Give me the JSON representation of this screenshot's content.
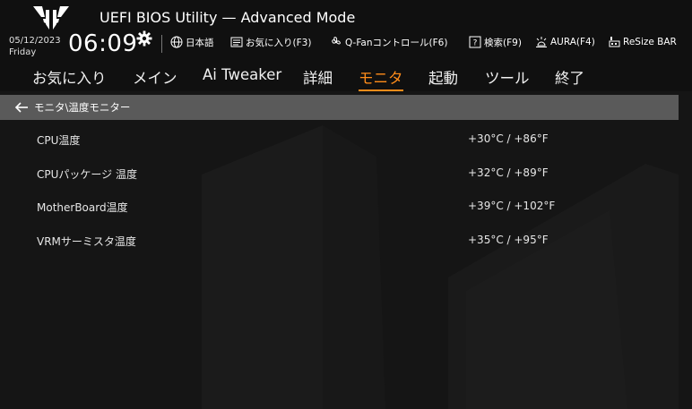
{
  "header": {
    "title": "UEFI BIOS Utility — Advanced Mode",
    "date": "05/12/2023",
    "day": "Friday",
    "time": "06:09"
  },
  "toolbar": {
    "language": "日本語",
    "favorites": "お気に入り(F3)",
    "qfan": "Q-Fanコントロール(F6)",
    "search": "検索(F9)",
    "aura": "AURA(F4)",
    "resize_bar": "ReSize BAR"
  },
  "nav": {
    "tabs": [
      {
        "label": "お気に入り"
      },
      {
        "label": "メイン"
      },
      {
        "label": "Ai Tweaker"
      },
      {
        "label": "詳細"
      },
      {
        "label": "モニタ"
      },
      {
        "label": "起動"
      },
      {
        "label": "ツール"
      },
      {
        "label": "終了"
      }
    ],
    "active": "モニタ"
  },
  "breadcrumb": {
    "text": "モニタ\\温度モニター"
  },
  "rows": [
    {
      "label": "CPU温度",
      "value": "+30°C / +86°F"
    },
    {
      "label": "CPUパッケージ 温度",
      "value": "+32°C / +89°F"
    },
    {
      "label": "MotherBoard温度",
      "value": "+39°C / +102°F"
    },
    {
      "label": "VRMサーミスタ温度",
      "value": "+35°C / +95°F"
    }
  ],
  "colors": {
    "accent": "#ff8c1a",
    "background": "#151515",
    "breadcrumb_bg": "#5a5a5a"
  },
  "icons": {
    "logo": "tuf-gaming-logo",
    "settings": "gear-icon",
    "language": "globe-icon",
    "favorites": "favorites-list-icon",
    "qfan": "fan-icon",
    "search": "question-search-icon",
    "aura": "aura-light-icon",
    "resize_bar": "resize-bar-icon",
    "back": "back-arrow-icon"
  }
}
